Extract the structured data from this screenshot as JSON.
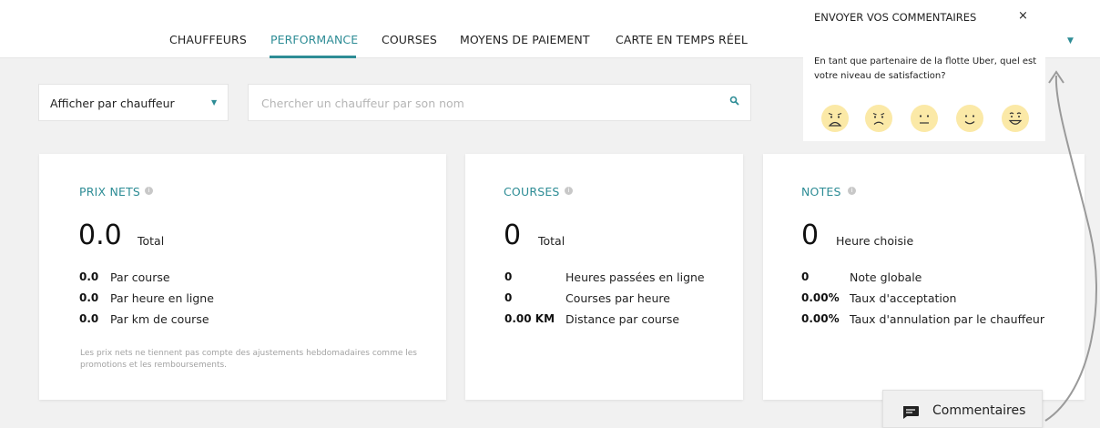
{
  "nav": {
    "tabs": [
      {
        "label": "CHAUFFEURS"
      },
      {
        "label": "PERFORMANCE"
      },
      {
        "label": "COURSES"
      },
      {
        "label": "MOYENS DE PAIEMENT"
      },
      {
        "label": "CARTE EN TEMPS RÉEL"
      }
    ],
    "active_tab": "PERFORMANCE",
    "accent": "#2d8c95"
  },
  "filters": {
    "view_select": {
      "value": "Afficher par chauffeur"
    },
    "search": {
      "placeholder": "Chercher un chauffeur par son nom",
      "value": ""
    }
  },
  "cards": {
    "net_prices": {
      "title": "PRIX NETS",
      "main_value": "0.0",
      "main_label": "Total",
      "rows": [
        {
          "value": "0.0",
          "label": "Par course"
        },
        {
          "value": "0.0",
          "label": "Par heure en ligne"
        },
        {
          "value": "0.0",
          "label": "Par km de course"
        }
      ],
      "footnote": "Les prix nets ne tiennent pas compte des ajustements hebdomadaires comme les promotions et les remboursements."
    },
    "trips": {
      "title": "COURSES",
      "main_value": "0",
      "main_label": "Total",
      "rows": [
        {
          "value": "0",
          "label": "Heures passées en ligne"
        },
        {
          "value": "0",
          "label": "Courses par heure"
        },
        {
          "value": "0.00 KM",
          "label": "Distance par course"
        }
      ]
    },
    "ratings": {
      "title": "NOTES",
      "main_value": "0",
      "main_label": "Heure choisie",
      "rows": [
        {
          "value": "0",
          "label": "Note globale"
        },
        {
          "value": "0.00%",
          "label": "Taux d'acceptation"
        },
        {
          "value": "0.00%",
          "label": "Taux d'annulation par le chauffeur"
        }
      ]
    }
  },
  "feedback": {
    "title": "ENVOYER VOS COMMENTAIRES",
    "close": "×",
    "question": "En tant que partenaire de la flotte Uber, quel est votre niveau de satisfaction?",
    "faces": [
      "very-unhappy-face-icon",
      "unhappy-face-icon",
      "neutral-face-icon",
      "happy-face-icon",
      "very-happy-face-icon"
    ],
    "face_color": "#fbe9a7",
    "button_label": "Commentaires"
  }
}
